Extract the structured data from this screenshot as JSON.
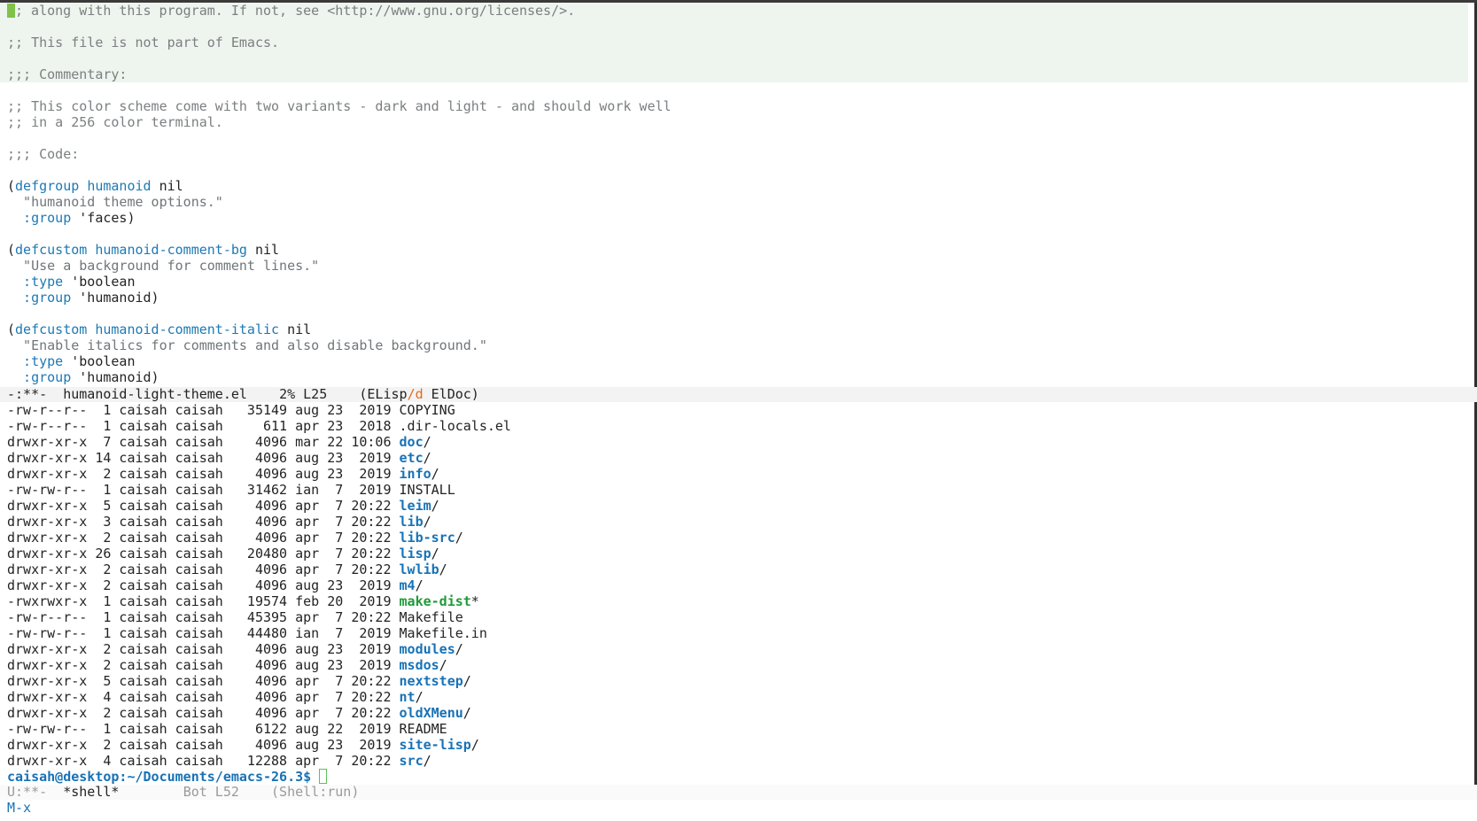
{
  "editor": {
    "lines": [
      {
        "type": "comment",
        "hl": true,
        "cursor": true,
        "text": ";; along with this program. If not, see <http://www.gnu.org/licenses/>."
      },
      {
        "type": "blank",
        "hl": true,
        "text": ""
      },
      {
        "type": "comment",
        "hl": true,
        "text": ";; This file is not part of Emacs."
      },
      {
        "type": "blank",
        "hl": true,
        "text": ""
      },
      {
        "type": "comment",
        "hl": true,
        "text": ";;; Commentary:"
      },
      {
        "type": "blank",
        "text": ""
      },
      {
        "type": "comment",
        "text": ";; This color scheme come with two variants - dark and light - and should work well"
      },
      {
        "type": "comment",
        "text": ";; in a 256 color terminal."
      },
      {
        "type": "blank",
        "text": ""
      },
      {
        "type": "comment",
        "text": ";;; Code:"
      },
      {
        "type": "blank",
        "text": ""
      },
      {
        "type": "def",
        "open": "(",
        "keyword": "defgroup",
        "name": "humanoid",
        "rest": " nil"
      },
      {
        "type": "str",
        "text": "  \"humanoid theme options.\""
      },
      {
        "type": "prop",
        "prop": "  :group",
        "rest": " 'faces)"
      },
      {
        "type": "blank",
        "text": ""
      },
      {
        "type": "def",
        "open": "(",
        "keyword": "defcustom",
        "name": "humanoid-comment-bg",
        "rest": " nil"
      },
      {
        "type": "str",
        "text": "  \"Use a background for comment lines.\""
      },
      {
        "type": "prop",
        "prop": "  :type",
        "rest": " 'boolean"
      },
      {
        "type": "prop",
        "prop": "  :group",
        "rest": " 'humanoid)"
      },
      {
        "type": "blank",
        "text": ""
      },
      {
        "type": "def",
        "open": "(",
        "keyword": "defcustom",
        "name": "humanoid-comment-italic",
        "rest": " nil"
      },
      {
        "type": "str",
        "text": "  \"Enable italics for comments and also disable background.\""
      },
      {
        "type": "prop",
        "prop": "  :type",
        "rest": " 'boolean"
      },
      {
        "type": "prop",
        "prop": "  :group",
        "rest": " 'humanoid)"
      }
    ]
  },
  "modeline_active": {
    "state": "-:**-",
    "buffer": "humanoid-light-theme.el",
    "position": "2% L25",
    "mode_prefix": "(ELisp",
    "mode_slash": "/d",
    "mode_suffix": " ElDoc)"
  },
  "shell": {
    "listing": [
      {
        "perm": "-rw-r--r--",
        "links": " 1",
        "user": "caisah",
        "group": "caisah",
        "size": "35149",
        "date": "aug 23  2019",
        "name": "COPYING",
        "kind": "file",
        "suffix": ""
      },
      {
        "perm": "-rw-r--r--",
        "links": " 1",
        "user": "caisah",
        "group": "caisah",
        "size": "611",
        "date": "apr 23  2018",
        "name": ".dir-locals.el",
        "kind": "file",
        "suffix": ""
      },
      {
        "perm": "drwxr-xr-x",
        "links": " 7",
        "user": "caisah",
        "group": "caisah",
        "size": "4096",
        "date": "mar 22 10:06",
        "name": "doc",
        "kind": "dir",
        "suffix": "/"
      },
      {
        "perm": "drwxr-xr-x",
        "links": "14",
        "user": "caisah",
        "group": "caisah",
        "size": "4096",
        "date": "aug 23  2019",
        "name": "etc",
        "kind": "dir",
        "suffix": "/"
      },
      {
        "perm": "drwxr-xr-x",
        "links": " 2",
        "user": "caisah",
        "group": "caisah",
        "size": "4096",
        "date": "aug 23  2019",
        "name": "info",
        "kind": "dir",
        "suffix": "/"
      },
      {
        "perm": "-rw-rw-r--",
        "links": " 1",
        "user": "caisah",
        "group": "caisah",
        "size": "31462",
        "date": "ian  7  2019",
        "name": "INSTALL",
        "kind": "file",
        "suffix": ""
      },
      {
        "perm": "drwxr-xr-x",
        "links": " 5",
        "user": "caisah",
        "group": "caisah",
        "size": "4096",
        "date": "apr  7 20:22",
        "name": "leim",
        "kind": "dir",
        "suffix": "/"
      },
      {
        "perm": "drwxr-xr-x",
        "links": " 3",
        "user": "caisah",
        "group": "caisah",
        "size": "4096",
        "date": "apr  7 20:22",
        "name": "lib",
        "kind": "dir",
        "suffix": "/"
      },
      {
        "perm": "drwxr-xr-x",
        "links": " 2",
        "user": "caisah",
        "group": "caisah",
        "size": "4096",
        "date": "apr  7 20:22",
        "name": "lib-src",
        "kind": "dir",
        "suffix": "/"
      },
      {
        "perm": "drwxr-xr-x",
        "links": "26",
        "user": "caisah",
        "group": "caisah",
        "size": "20480",
        "date": "apr  7 20:22",
        "name": "lisp",
        "kind": "dir",
        "suffix": "/"
      },
      {
        "perm": "drwxr-xr-x",
        "links": " 2",
        "user": "caisah",
        "group": "caisah",
        "size": "4096",
        "date": "apr  7 20:22",
        "name": "lwlib",
        "kind": "dir",
        "suffix": "/"
      },
      {
        "perm": "drwxr-xr-x",
        "links": " 2",
        "user": "caisah",
        "group": "caisah",
        "size": "4096",
        "date": "aug 23  2019",
        "name": "m4",
        "kind": "dir",
        "suffix": "/"
      },
      {
        "perm": "-rwxrwxr-x",
        "links": " 1",
        "user": "caisah",
        "group": "caisah",
        "size": "19574",
        "date": "feb 20  2019",
        "name": "make-dist",
        "kind": "exe",
        "suffix": "*"
      },
      {
        "perm": "-rw-r--r--",
        "links": " 1",
        "user": "caisah",
        "group": "caisah",
        "size": "45395",
        "date": "apr  7 20:22",
        "name": "Makefile",
        "kind": "file",
        "suffix": ""
      },
      {
        "perm": "-rw-rw-r--",
        "links": " 1",
        "user": "caisah",
        "group": "caisah",
        "size": "44480",
        "date": "ian  7  2019",
        "name": "Makefile.in",
        "kind": "file",
        "suffix": ""
      },
      {
        "perm": "drwxr-xr-x",
        "links": " 2",
        "user": "caisah",
        "group": "caisah",
        "size": "4096",
        "date": "aug 23  2019",
        "name": "modules",
        "kind": "dir",
        "suffix": "/"
      },
      {
        "perm": "drwxr-xr-x",
        "links": " 2",
        "user": "caisah",
        "group": "caisah",
        "size": "4096",
        "date": "aug 23  2019",
        "name": "msdos",
        "kind": "dir",
        "suffix": "/"
      },
      {
        "perm": "drwxr-xr-x",
        "links": " 5",
        "user": "caisah",
        "group": "caisah",
        "size": "4096",
        "date": "apr  7 20:22",
        "name": "nextstep",
        "kind": "dir",
        "suffix": "/"
      },
      {
        "perm": "drwxr-xr-x",
        "links": " 4",
        "user": "caisah",
        "group": "caisah",
        "size": "4096",
        "date": "apr  7 20:22",
        "name": "nt",
        "kind": "dir",
        "suffix": "/"
      },
      {
        "perm": "drwxr-xr-x",
        "links": " 2",
        "user": "caisah",
        "group": "caisah",
        "size": "4096",
        "date": "apr  7 20:22",
        "name": "oldXMenu",
        "kind": "dir",
        "suffix": "/"
      },
      {
        "perm": "-rw-rw-r--",
        "links": " 1",
        "user": "caisah",
        "group": "caisah",
        "size": "6122",
        "date": "aug 22  2019",
        "name": "README",
        "kind": "file",
        "suffix": ""
      },
      {
        "perm": "drwxr-xr-x",
        "links": " 2",
        "user": "caisah",
        "group": "caisah",
        "size": "4096",
        "date": "aug 23  2019",
        "name": "site-lisp",
        "kind": "dir",
        "suffix": "/"
      },
      {
        "perm": "drwxr-xr-x",
        "links": " 4",
        "user": "caisah",
        "group": "caisah",
        "size": "12288",
        "date": "apr  7 20:22",
        "name": "src",
        "kind": "dir",
        "suffix": "/"
      }
    ],
    "prompt": "caisah@desktop:~/Documents/emacs-26.3$"
  },
  "modeline_inactive": {
    "state": "U:**-",
    "buffer": "*shell*",
    "position": "Bot L52",
    "mode": "(Shell:run)"
  },
  "minibuffer": {
    "text": "M-x"
  },
  "colors": {
    "keyword": "#1c79b5",
    "directory": "#1872b6",
    "executable": "#1f9a38",
    "comment": "#7b7f81",
    "cursor": "#7fc24a",
    "mode_accent": "#e46b1a"
  }
}
